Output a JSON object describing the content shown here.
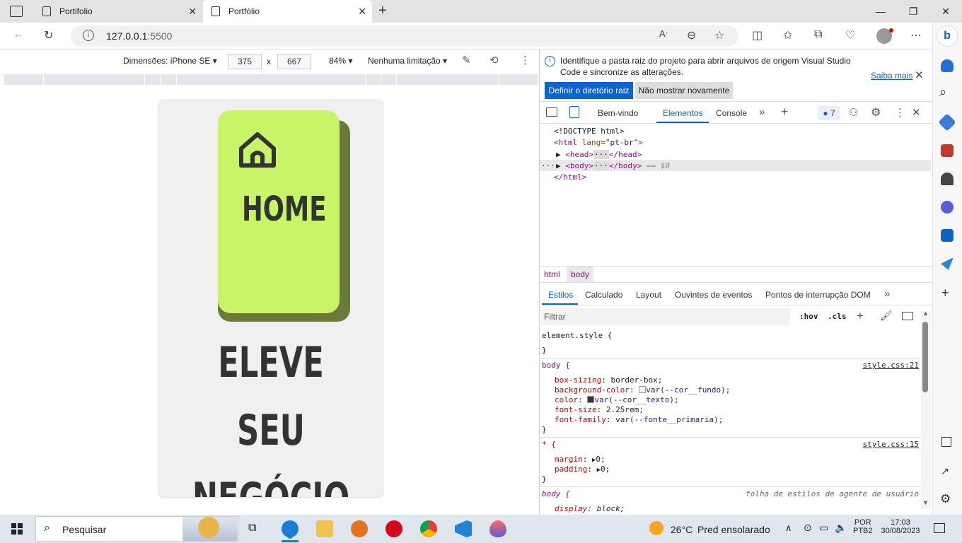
{
  "browser": {
    "tabs": [
      {
        "title": "Portifolio"
      },
      {
        "title": "Portfólio"
      }
    ],
    "new_tab": "+",
    "window_controls": {
      "minimize": "—",
      "maximize": "❐",
      "close": "✕"
    },
    "url": "127.0.0.1",
    "url_port": ":5500"
  },
  "device_toolbar": {
    "dimensions_label": "Dimensões: iPhone SE",
    "width": "375",
    "times": "x",
    "height": "667",
    "zoom": "84%",
    "throttle": "Nenhuma limitação"
  },
  "page": {
    "card_title": "HOME",
    "headline_lines": [
      "ELEVE",
      "SEU",
      "NEGÓCIO"
    ]
  },
  "devtools": {
    "info_text_line1": "Identifique a pasta raiz do projeto para abrir arquivos de origem Visual Studio",
    "info_text_line2": "Code e sincronize as alterações.",
    "info_learn": "Saiba mais",
    "btn_set_root": "Definir o diretório raiz",
    "btn_dont_show": "Não mostrar novamente",
    "tabs": [
      "Bem-vindo",
      "Elementos",
      "Console"
    ],
    "issues_count": "7",
    "dom": {
      "doctype": "<!DOCTYPE html>",
      "html_open_tag": "<html",
      "html_attr": "lang",
      "html_attr_val": "\"pt-br\"",
      "head_open": "<head>",
      "head_close": "</head>",
      "body_open": "<body>",
      "body_close": "</body>",
      "body_eq": "== $0",
      "html_close": "</html>",
      "ellipsis": "···"
    },
    "breadcrumbs": [
      "html",
      "body"
    ],
    "style_tabs": [
      "Estilos",
      "Calculado",
      "Layout",
      "Ouvintes de eventos",
      "Pontos de interrupção DOM"
    ],
    "filter_placeholder": "Filtrar",
    "hov": ":hov",
    "cls": ".cls",
    "rules": {
      "element_style": "element.style {",
      "close_brace": "}",
      "body_selector": "body {",
      "body_link": "style.css:21",
      "body_props": [
        {
          "name": "box-sizing",
          "value": "border-box;"
        },
        {
          "name": "background-color",
          "value": "var(--cor__fundo);"
        },
        {
          "name": "color",
          "value": "var(--cor__texto);"
        },
        {
          "name": "font-size",
          "value": "2.25rem;"
        },
        {
          "name": "font-family",
          "value": "var(--fonte__primaria);"
        }
      ],
      "star_selector": "* {",
      "star_link": "style.css:15",
      "star_props": [
        {
          "name": "margin",
          "value": "0;"
        },
        {
          "name": "padding",
          "value": "0;"
        }
      ],
      "ua_selector": "body {",
      "ua_label": "folha de estilos de agente de usuário",
      "ua_prop_name": "display",
      "ua_prop_value": "block;"
    }
  },
  "taskbar": {
    "search_label": "Pesquisar",
    "weather_temp": "26°C",
    "weather_text": "Pred ensolarado",
    "lang_top": "POR",
    "lang_bottom": "PTB2",
    "time": "17:03",
    "date": "30/08/2023"
  },
  "colors": {
    "card": "#c7f567",
    "card_shadow": "#6b7a3a",
    "accent": "#0b63d4"
  }
}
